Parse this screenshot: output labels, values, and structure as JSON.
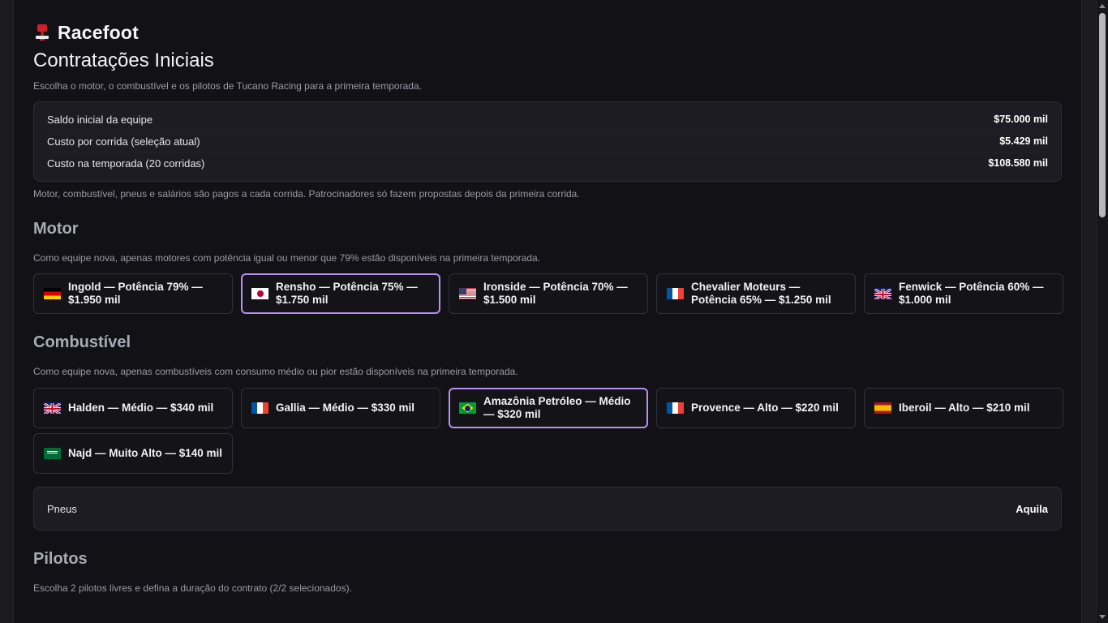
{
  "app": {
    "brand": "Racefoot",
    "icon": "trophy-icon"
  },
  "page": {
    "title": "Contratações Iniciais",
    "subtitle": "Escolha o motor, o combustível e os pilotos de Tucano Racing para a primeira temporada."
  },
  "budget": {
    "rows": [
      {
        "label": "Saldo inicial da equipe",
        "value": "$75.000 mil"
      },
      {
        "label": "Custo por corrida (seleção atual)",
        "value": "$5.429 mil"
      },
      {
        "label": "Custo na temporada (20 corridas)",
        "value": "$108.580 mil"
      }
    ],
    "note": "Motor, combustível, pneus e salários são pagos a cada corrida. Patrocinadores só fazem propostas depois da primeira corrida."
  },
  "motor": {
    "title": "Motor",
    "desc": "Como equipe nova, apenas motores com potência igual ou menor que 79% estão disponíveis na primeira temporada.",
    "options": [
      {
        "label": "Ingold — Potência 79% — $1.950 mil",
        "flag": "germany-flag",
        "selected": false
      },
      {
        "label": "Rensho — Potência 75% — $1.750 mil",
        "flag": "japan-flag",
        "selected": true
      },
      {
        "label": "Ironside — Potência 70% — $1.500 mil",
        "flag": "usa-flag",
        "selected": false
      },
      {
        "label": "Chevalier Moteurs — Potência 65% — $1.250 mil",
        "flag": "france-flag",
        "selected": false
      },
      {
        "label": "Fenwick — Potência 60% — $1.000 mil",
        "flag": "uk-flag",
        "selected": false
      }
    ]
  },
  "fuel": {
    "title": "Combustível",
    "desc": "Como equipe nova, apenas combustíveis com consumo médio ou pior estão disponíveis na primeira temporada.",
    "options": [
      {
        "label": "Halden — Médio — $340 mil",
        "flag": "uk-flag",
        "selected": false
      },
      {
        "label": "Gallia — Médio — $330 mil",
        "flag": "france-flag",
        "selected": false
      },
      {
        "label": "Amazônia Petróleo — Médio — $320 mil",
        "flag": "brazil-flag",
        "selected": true
      },
      {
        "label": "Provence — Alto — $220 mil",
        "flag": "france-flag",
        "selected": false
      },
      {
        "label": "Iberoil — Alto — $210 mil",
        "flag": "spain-flag",
        "selected": false
      },
      {
        "label": "Najd — Muito Alto — $140 mil",
        "flag": "saudi-flag",
        "selected": false
      }
    ]
  },
  "tyres": {
    "label": "Pneus",
    "value": "Aquila"
  },
  "pilots": {
    "title": "Pilotos",
    "desc": "Escolha 2 pilotos livres e defina a duração do contrato (2/2 selecionados)."
  },
  "colors": {
    "accent": "#b98ff0",
    "background": "#121216",
    "card": "#1c1c22"
  }
}
